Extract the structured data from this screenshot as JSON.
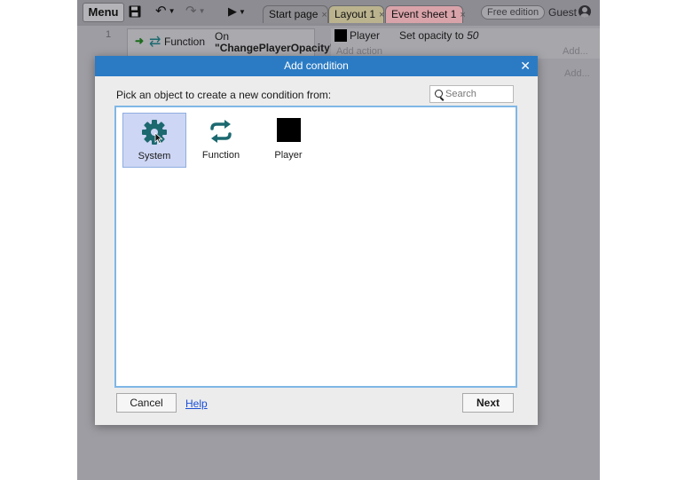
{
  "toolbar": {
    "menu_label": "Menu",
    "tabs": [
      {
        "label": "Start page",
        "color": "#8e8e93"
      },
      {
        "label": "Layout 1",
        "color": "#bab38e"
      },
      {
        "label": "Event sheet 1",
        "color": "#d9a3aa"
      }
    ],
    "tab_close_glyph": "×",
    "free_badge": "Free edition",
    "guest_label": "Guest",
    "icons": [
      "save-icon",
      "undo-icon",
      "redo-icon",
      "play-icon",
      "user-icon"
    ]
  },
  "event_sheet": {
    "event_number": "1",
    "condition": {
      "object": "Function",
      "trigger": "On",
      "parameter": "\"ChangePlayerOpacity\""
    },
    "action": {
      "object": "Player",
      "text": "Set opacity to",
      "value": "50"
    },
    "add_action_label": "Add action",
    "add_action_short": "Add..."
  },
  "dialog": {
    "title": "Add condition",
    "prompt": "Pick an object to create a new condition from:",
    "search_placeholder": "Search",
    "objects": [
      {
        "label": "System",
        "icon": "gear-icon",
        "selected": true
      },
      {
        "label": "Function",
        "icon": "function-icon",
        "selected": false
      },
      {
        "label": "Player",
        "icon": "player-sprite-icon",
        "selected": false
      }
    ],
    "cancel_label": "Cancel",
    "help_label": "Help",
    "next_label": "Next"
  },
  "colors": {
    "dialog_titlebar": "#2b7bc4",
    "selection": "#cdd6f4",
    "icon_teal": "#1c6970"
  }
}
